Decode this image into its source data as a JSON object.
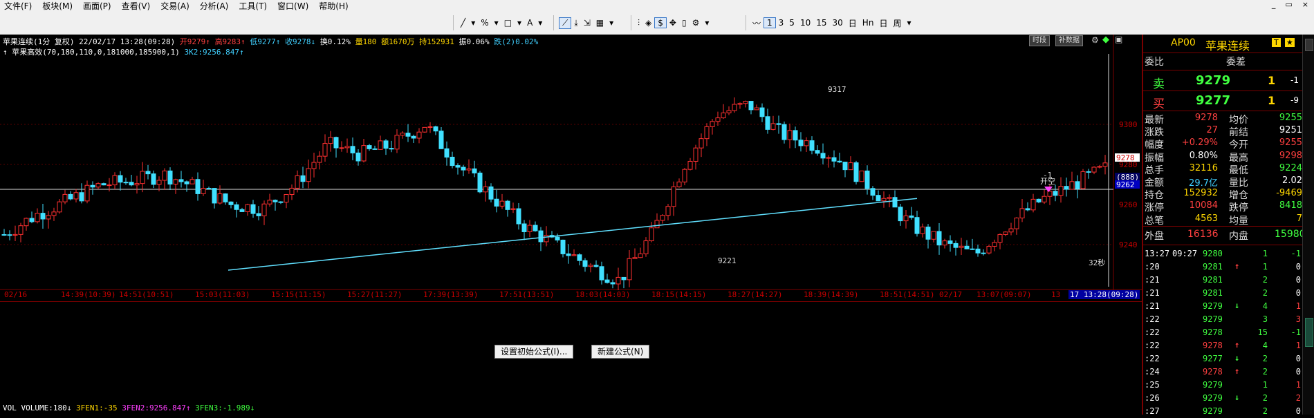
{
  "menu": [
    "文件(F)",
    "板块(M)",
    "画面(P)",
    "查看(V)",
    "交易(A)",
    "分析(A)",
    "工具(T)",
    "窗口(W)",
    "帮助(H)"
  ],
  "window_controls": [
    "_",
    "▭",
    "×"
  ],
  "toolbar": {
    "line_tool": "╱",
    "percent": "%",
    "rect": "□",
    "text": "A",
    "dollar": "$",
    "periods": [
      "1",
      "3",
      "5",
      "10",
      "15",
      "30",
      "日",
      "Hn",
      "日",
      "周"
    ],
    "active_period": "1"
  },
  "info": {
    "line1": [
      {
        "t": "苹果连续(1分 复权) 22/02/17 13:28(09:28) ",
        "c": "#ffffff"
      },
      {
        "t": "开9279↑ ",
        "c": "#ff4040"
      },
      {
        "t": "高9283↑ ",
        "c": "#ff4040"
      },
      {
        "t": "低9277↑ ",
        "c": "#40d0ff"
      },
      {
        "t": "收9278↓ ",
        "c": "#40d0ff"
      },
      {
        "t": "换0.12% ",
        "c": "#ffffff"
      },
      {
        "t": "量180 ",
        "c": "#ffd700"
      },
      {
        "t": "额1670万 ",
        "c": "#ffd700"
      },
      {
        "t": "持152931 ",
        "c": "#ffd700"
      },
      {
        "t": "振0.06% ",
        "c": "#ffffff"
      },
      {
        "t": "跌(2)0.02%",
        "c": "#40d0ff"
      }
    ],
    "line2_name": "↑ 苹果高效(70,180,110,0,181000,185900,1)",
    "line2_val": "3K2:9256.847↑",
    "btn1": "时段",
    "btn2": "补数据"
  },
  "price_labels": {
    "hi": "9317",
    "lo": "9221",
    "countdown": "32秒",
    "signal_top": "-1",
    "signal_label": "开空"
  },
  "y_axis": [
    "9300",
    "9280",
    "9260",
    "9240"
  ],
  "y_badges": {
    "cur": "9278",
    "b1": "(888)",
    "b2": "9262"
  },
  "time_axis": [
    "02/16",
    "14:39(10:39)",
    "14:51(10:51)",
    "15:03(11:03)",
    "15:15(11:15)",
    "15:27(11:27)",
    "17:39(13:39)",
    "17:51(13:51)",
    "18:03(14:03)",
    "18:15(14:15)",
    "18:27(14:27)",
    "18:39(14:39)",
    "18:51(14:51)",
    "02/17",
    "13:07(09:07)",
    "13",
    "17 13:28(09:28)"
  ],
  "dialog_buttons": [
    "设置初始公式(I)...",
    "新建公式(N)"
  ],
  "vol_info": [
    {
      "t": "VOL VOLUME:180↓ ",
      "c": "#ffffff"
    },
    {
      "t": "3FEN1:-35 ",
      "c": "#ffd700"
    },
    {
      "t": "3FEN2:9256.847↑ ",
      "c": "#ff40ff"
    },
    {
      "t": "3FEN3:-1.989↓",
      "c": "#40ff40"
    }
  ],
  "panel": {
    "code": "AP00",
    "name": "苹果连续",
    "icons": [
      "T",
      "★"
    ],
    "wei_bi": "委比",
    "wei_cha": "委差",
    "sell": {
      "label": "卖",
      "price": "9279",
      "vol": "1",
      "chg": "-1"
    },
    "buy": {
      "label": "买",
      "price": "9277",
      "vol": "1",
      "chg": "-9"
    },
    "stats": [
      {
        "l": "最新",
        "v": "9278",
        "vc": "#ff4040",
        "l2": "均价",
        "v2": "9255",
        "v2c": "#40ff40"
      },
      {
        "l": "涨跌",
        "v": "27",
        "vc": "#ff4040",
        "l2": "前结",
        "v2": "9251",
        "v2c": "#ffffff"
      },
      {
        "l": "幅度",
        "v": "+0.29%",
        "vc": "#ff4040",
        "l2": "今开",
        "v2": "9255",
        "v2c": "#ff4040"
      },
      {
        "l": "振幅",
        "v": "0.80%",
        "vc": "#ffffff",
        "l2": "最高",
        "v2": "9298",
        "v2c": "#ff4040"
      },
      {
        "l": "总手",
        "v": "32116",
        "vc": "#ffd700",
        "l2": "最低",
        "v2": "9224",
        "v2c": "#40ff40"
      },
      {
        "l": "金额",
        "v": "29.7亿",
        "vc": "#40d0ff",
        "l2": "量比",
        "v2": "2.02",
        "v2c": "#ffffff"
      },
      {
        "l": "持仓",
        "v": "152932",
        "vc": "#ffd700",
        "l2": "增仓",
        "v2": "-9469",
        "v2c": "#ffd700"
      },
      {
        "l": "涨停",
        "v": "10084",
        "vc": "#ff4040",
        "l2": "跌停",
        "v2": "8418",
        "v2c": "#40ff40"
      },
      {
        "l": "总笔",
        "v": "4563",
        "vc": "#ffd700",
        "l2": "均量",
        "v2": "7",
        "v2c": "#ffd700"
      }
    ],
    "outer": {
      "l": "外盘",
      "v": "16136",
      "l2": "内盘",
      "v2": "15980"
    },
    "ticks": [
      {
        "t": "13:27",
        "t2": "09:27",
        "p": "9280",
        "pc": "#40ff40",
        "a": "",
        "ac": "#ffffff",
        "v": "1",
        "c": "-1",
        "cc": "#40ff40"
      },
      {
        "t": ":20",
        "t2": "",
        "p": "9281",
        "pc": "#40ff40",
        "a": "↑",
        "ac": "#ff4040",
        "v": "1",
        "c": "0",
        "cc": "#ffffff"
      },
      {
        "t": ":21",
        "t2": "",
        "p": "9281",
        "pc": "#40ff40",
        "a": "",
        "ac": "#ffffff",
        "v": "2",
        "c": "0",
        "cc": "#ffffff"
      },
      {
        "t": ":21",
        "t2": "",
        "p": "9281",
        "pc": "#40ff40",
        "a": "",
        "ac": "#ffffff",
        "v": "2",
        "c": "0",
        "cc": "#ffffff"
      },
      {
        "t": ":21",
        "t2": "",
        "p": "9279",
        "pc": "#40ff40",
        "a": "↓",
        "ac": "#40ff40",
        "v": "4",
        "c": "1",
        "cc": "#ff4040"
      },
      {
        "t": ":22",
        "t2": "",
        "p": "9279",
        "pc": "#40ff40",
        "a": "",
        "ac": "#ffffff",
        "v": "3",
        "c": "3",
        "cc": "#ff4040"
      },
      {
        "t": ":22",
        "t2": "",
        "p": "9278",
        "pc": "#40ff40",
        "a": "",
        "ac": "#ffffff",
        "v": "15",
        "c": "-1",
        "cc": "#40ff40"
      },
      {
        "t": ":22",
        "t2": "",
        "p": "9278",
        "pc": "#ff4040",
        "a": "↑",
        "ac": "#ff4040",
        "v": "4",
        "c": "1",
        "cc": "#ff4040"
      },
      {
        "t": ":22",
        "t2": "",
        "p": "9277",
        "pc": "#40ff40",
        "a": "↓",
        "ac": "#40ff40",
        "v": "2",
        "c": "0",
        "cc": "#ffffff"
      },
      {
        "t": ":24",
        "t2": "",
        "p": "9278",
        "pc": "#ff4040",
        "a": "↑",
        "ac": "#ff4040",
        "v": "2",
        "c": "0",
        "cc": "#ffffff"
      },
      {
        "t": ":25",
        "t2": "",
        "p": "9279",
        "pc": "#40ff40",
        "a": "",
        "ac": "#ffffff",
        "v": "1",
        "c": "1",
        "cc": "#ff4040"
      },
      {
        "t": ":26",
        "t2": "",
        "p": "9279",
        "pc": "#40ff40",
        "a": "↓",
        "ac": "#40ff40",
        "v": "2",
        "c": "2",
        "cc": "#ff4040"
      },
      {
        "t": ":27",
        "t2": "",
        "p": "9279",
        "pc": "#40ff40",
        "a": "",
        "ac": "#ffffff",
        "v": "2",
        "c": "0",
        "cc": "#ffffff"
      }
    ]
  }
}
